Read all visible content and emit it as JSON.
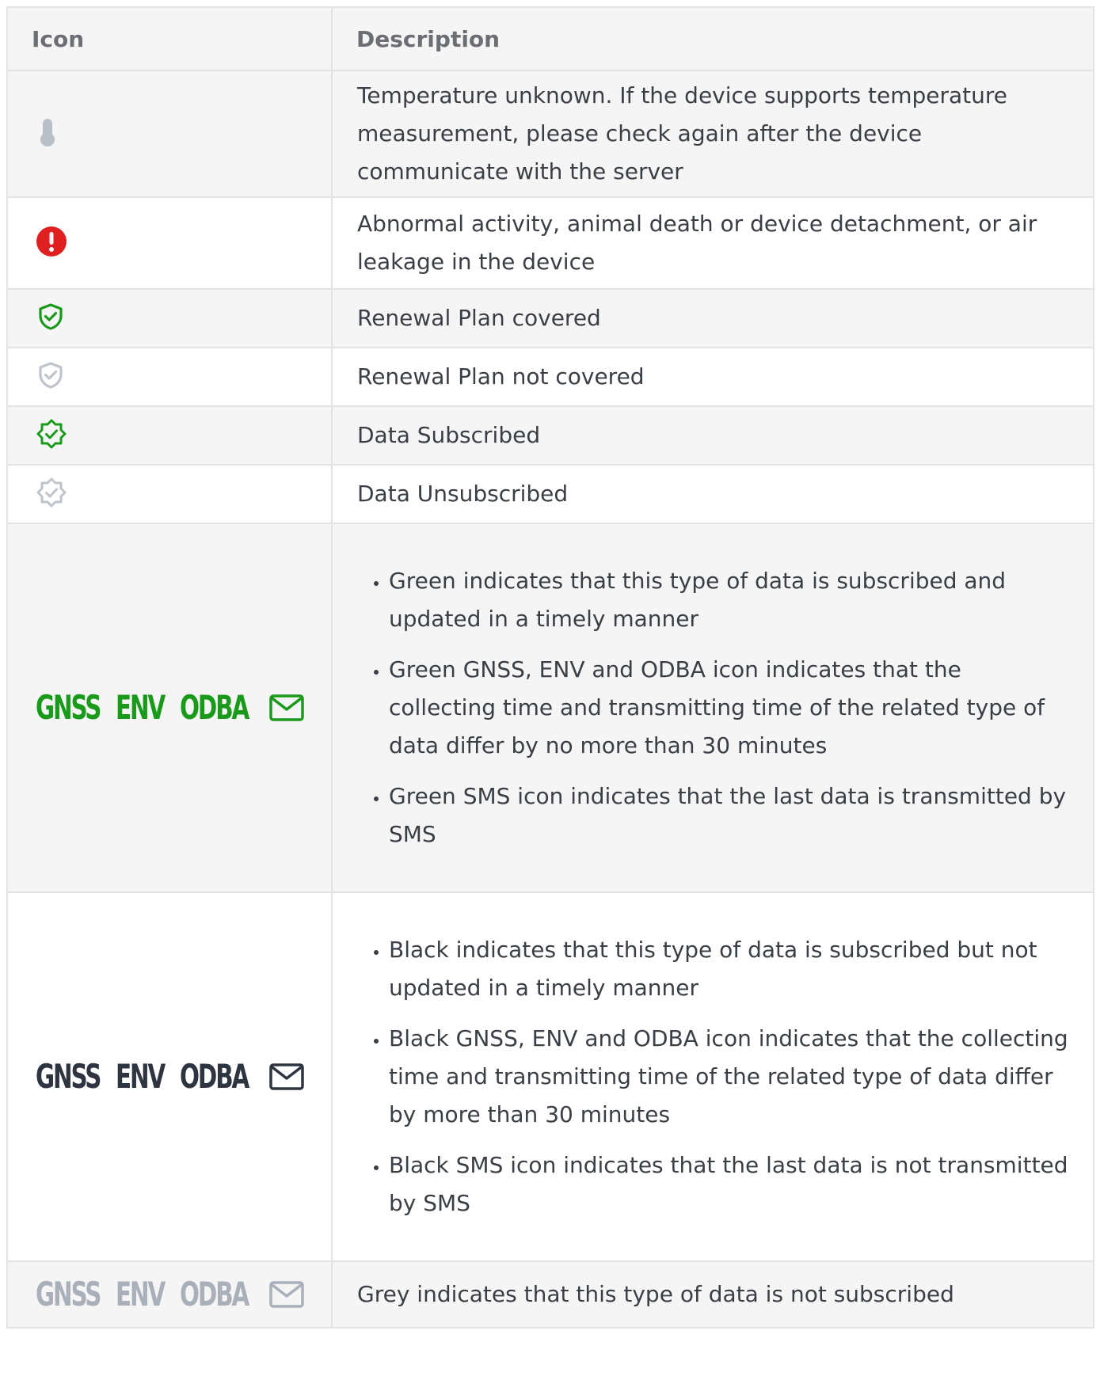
{
  "header": {
    "icon_col": "Icon",
    "description_col": "Description"
  },
  "rows": [
    {
      "icon": "thermometer-icon",
      "color": "#b9bfc7",
      "description": "Temperature unknown. If the device supports temperature measurement, please check again after the device communicate with the server"
    },
    {
      "icon": "exclamation-circle-icon",
      "color": "#e02020",
      "description": "Abnormal activity, animal death or device detachment, or air leakage in the device"
    },
    {
      "icon": "shield-check-icon",
      "color": "#1a9a1a",
      "description": "Renewal Plan covered"
    },
    {
      "icon": "shield-check-icon",
      "color": "#bfc4cb",
      "description": "Renewal Plan not covered"
    },
    {
      "icon": "badge-check-icon",
      "color": "#1a9a1a",
      "description": "Data Subscribed"
    },
    {
      "icon": "badge-check-icon",
      "color": "#bfc4cb",
      "description": "Data Unsubscribed"
    }
  ],
  "badge_labels": {
    "gnss": "GNSS",
    "env": "ENV",
    "odba": "ODBA",
    "sms": "sms-mail-icon"
  },
  "green_row": {
    "color": "#1a9a1a",
    "bullets": [
      "Green indicates that this type of data is subscribed and updated in a timely manner",
      "Green GNSS, ENV and ODBA icon indicates that the collecting time and transmitting time of the related type of data differ by no more than 30 minutes",
      "Green SMS icon indicates that the last data is transmitted by SMS"
    ]
  },
  "black_row": {
    "color": "#2e3540",
    "bullets": [
      "Black indicates that this type of data is subscribed but not updated in a timely manner",
      "Black GNSS, ENV and ODBA icon indicates that the collecting time and transmitting time of the related type of data differ by more than 30 minutes",
      "Black SMS icon indicates that the last data is not transmitted by SMS"
    ]
  },
  "grey_row": {
    "color": "#a9b0ba",
    "description": "Grey indicates that this type of data is not subscribed"
  }
}
